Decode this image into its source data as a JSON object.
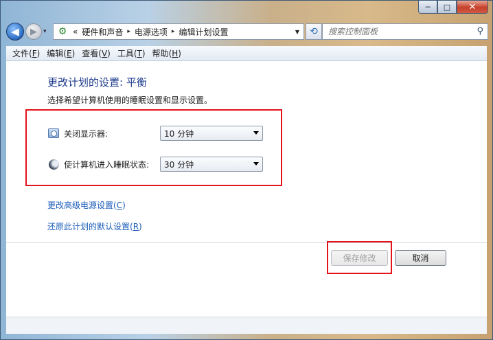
{
  "window": {
    "caption": {
      "minimize": "─",
      "maximize": "□",
      "close": "✕"
    }
  },
  "nav": {
    "back_glyph": "◀",
    "forward_glyph": "▶",
    "recent_glyph": "▾",
    "address": {
      "overflow": "«",
      "breadcrumbs": [
        "硬件和声音",
        "电源选项",
        "编辑计划设置"
      ],
      "separator": "▸",
      "dropdown_glyph": "▼"
    },
    "refresh_glyph": "⟲",
    "search": {
      "placeholder": "搜索控制面板",
      "icon_glyph": "⚲"
    }
  },
  "menu": [
    {
      "label": "文件(",
      "key": "F",
      "end": ")"
    },
    {
      "label": "编辑(",
      "key": "E",
      "end": ")"
    },
    {
      "label": "查看(",
      "key": "V",
      "end": ")"
    },
    {
      "label": "工具(",
      "key": "T",
      "end": ")"
    },
    {
      "label": "帮助(",
      "key": "H",
      "end": ")"
    }
  ],
  "content": {
    "title": "更改计划的设置: 平衡",
    "description": "选择希望计算机使用的睡眠设置和显示设置。",
    "display_off": {
      "label": "关闭显示器:",
      "value": "10 分钟"
    },
    "sleep": {
      "label": "使计算机进入睡眠状态:",
      "value": "30 分钟"
    },
    "link_advanced": {
      "text": "更改高级电源设置(",
      "key": "C",
      "end": ")"
    },
    "link_restore": {
      "text": "还原此计划的默认设置(",
      "key": "R",
      "end": ")"
    },
    "save_button": "保存修改",
    "cancel_button": "取消"
  }
}
